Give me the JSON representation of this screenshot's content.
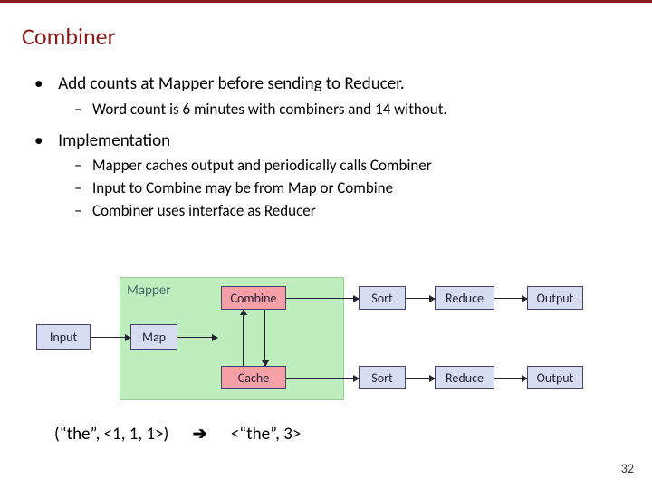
{
  "title": "Combiner",
  "bullets": {
    "b1": "Add counts at Mapper before sending to Reducer.",
    "b1_sub1": "Word count is 6 minutes with combiners and 14 without.",
    "b2": "Implementation",
    "b2_sub1": "Mapper caches output and periodically calls Combiner",
    "b2_sub2": "Input to Combine may be from Map or Combine",
    "b2_sub3": "Combiner uses interface as Reducer"
  },
  "diagram": {
    "mapper_label": "Mapper",
    "input": "Input",
    "map": "Map",
    "combine": "Combine",
    "cache": "Cache",
    "sort": "Sort",
    "reduce": "Reduce",
    "output": "Output"
  },
  "example": {
    "left": "(“the”, <1,  1, 1>)",
    "arrow": "➔",
    "right": "<“the”, 3>"
  },
  "page_number": "32"
}
